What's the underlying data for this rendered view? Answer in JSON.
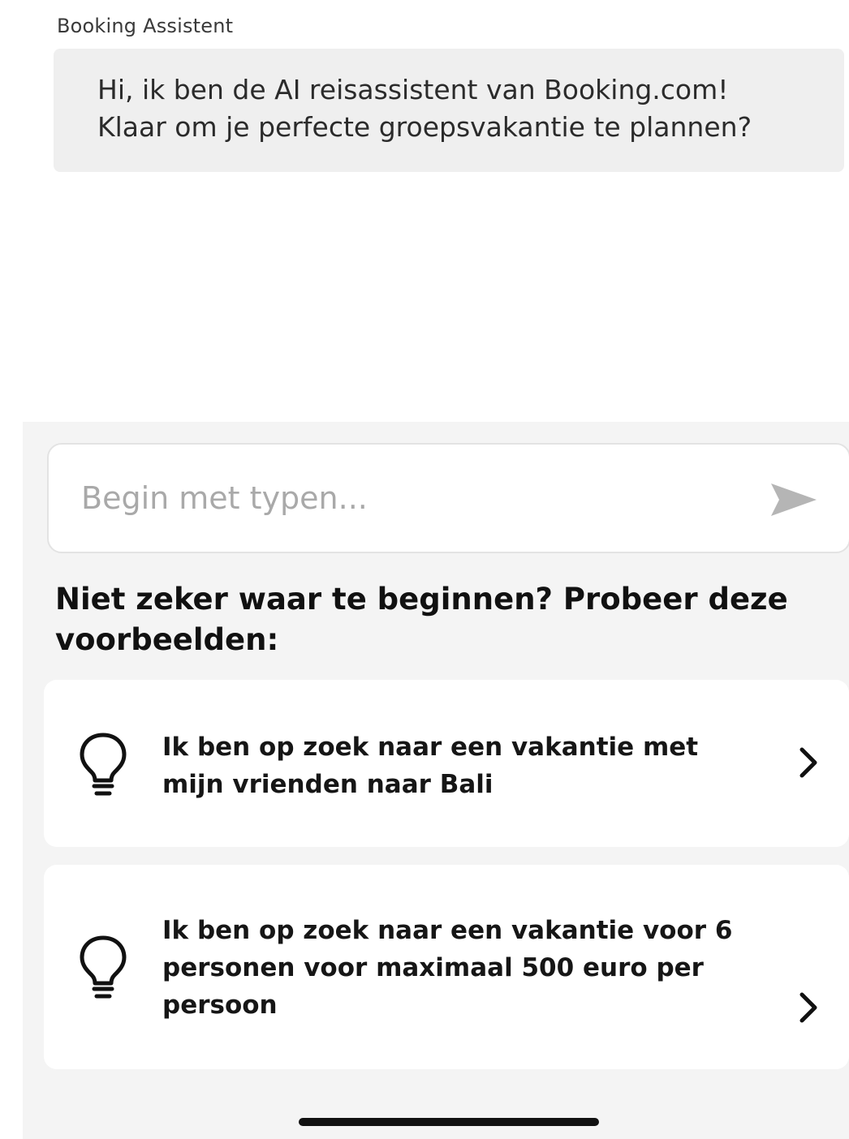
{
  "chat": {
    "sender": "Booking Assistent",
    "message": "Hi, ik ben de AI reisassistent van Booking.com!\nKlaar om je perfecte groepsvakantie te plannen?"
  },
  "composer": {
    "placeholder": "Begin met typen...",
    "value": "",
    "send_icon": "send-arrow-icon"
  },
  "suggestions": {
    "heading": "Niet zeker waar te beginnen? Probeer deze voorbeelden:",
    "items": [
      {
        "text": "Ik ben op zoek naar een vakantie met mijn vrienden naar Bali",
        "icon": "lightbulb-icon"
      },
      {
        "text": "Ik ben op zoek naar een vakantie voor 6 personen voor maximaal 500 euro per persoon",
        "icon": "lightbulb-icon"
      }
    ]
  },
  "colors": {
    "bubble_bg": "#efefef",
    "panel_bg": "#f4f4f4",
    "card_bg": "#ffffff",
    "placeholder": "#a9a9a9",
    "send_icon": "#b5b5b5"
  }
}
